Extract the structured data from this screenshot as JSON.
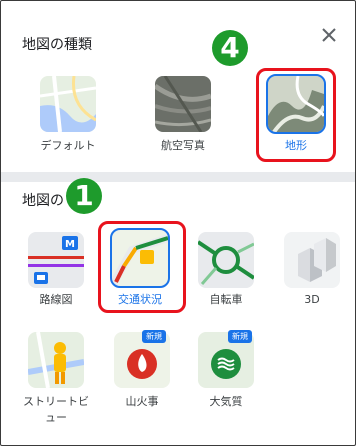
{
  "map_types": {
    "title": "地図の種類",
    "items": [
      {
        "label": "デフォルト"
      },
      {
        "label": "航空写真"
      },
      {
        "label": "地形",
        "selected": true
      }
    ]
  },
  "map_details": {
    "title": "地図の",
    "items": [
      {
        "label": "路線図",
        "icon_text": "M"
      },
      {
        "label": "交通状況",
        "selected": true
      },
      {
        "label": "自転車"
      },
      {
        "label": "3D"
      },
      {
        "label_line1": "ストリートビ",
        "label_line2": "ュー"
      },
      {
        "label": "山火事",
        "tag": "新規"
      },
      {
        "label": "大気質",
        "tag": "新規"
      }
    ]
  },
  "annotations": {
    "badge_1": "1",
    "badge_4": "4"
  },
  "colors": {
    "highlight_red": "#e8131d",
    "badge_green": "#1e9b2c",
    "selected_blue": "#1a73e8"
  }
}
